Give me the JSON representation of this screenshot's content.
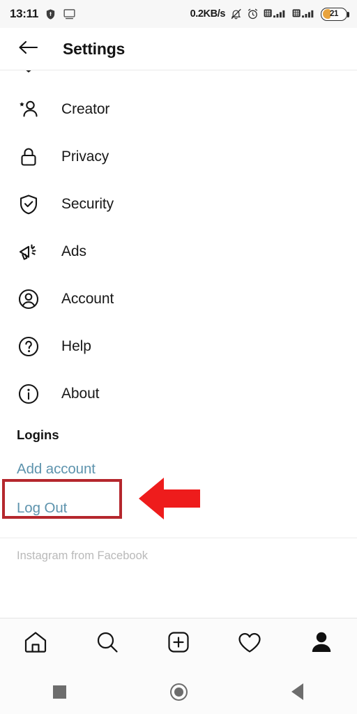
{
  "status_bar": {
    "time": "13:11",
    "network_speed": "0.2KB/s",
    "battery_percent": "21",
    "icons": [
      "shield-icon",
      "cast-screen-icon",
      "bell-muted-icon",
      "alarm-clock-icon",
      "sim1-signal-icon",
      "sim2-signal-icon",
      "battery-icon"
    ]
  },
  "header": {
    "title": "Settings",
    "back_icon": "arrow-left-icon"
  },
  "settings": {
    "items": [
      {
        "label": "Creator",
        "icon": "creator-star-person-icon"
      },
      {
        "label": "Privacy",
        "icon": "lock-icon"
      },
      {
        "label": "Security",
        "icon": "shield-check-icon"
      },
      {
        "label": "Ads",
        "icon": "megaphone-icon"
      },
      {
        "label": "Account",
        "icon": "account-circle-icon"
      },
      {
        "label": "Help",
        "icon": "question-circle-icon"
      },
      {
        "label": "About",
        "icon": "info-circle-icon"
      }
    ]
  },
  "logins": {
    "section_title": "Logins",
    "add_account_label": "Add account",
    "log_out_label": "Log Out",
    "link_color": "#5d93ad",
    "highlight_color": "#b5272d",
    "arrow_color": "#ee1c1c"
  },
  "footer": {
    "note": "Instagram from Facebook"
  },
  "tabbar": {
    "tabs": [
      {
        "name": "home",
        "icon": "home-icon",
        "active": false
      },
      {
        "name": "search",
        "icon": "search-icon",
        "active": false
      },
      {
        "name": "create",
        "icon": "plus-square-icon",
        "active": false
      },
      {
        "name": "activity",
        "icon": "heart-icon",
        "active": false
      },
      {
        "name": "profile",
        "icon": "person-filled-icon",
        "active": true
      }
    ]
  },
  "android_nav": {
    "buttons": [
      {
        "name": "recents",
        "icon": "square-icon"
      },
      {
        "name": "home",
        "icon": "circle-icon"
      },
      {
        "name": "back",
        "icon": "triangle-left-icon"
      }
    ]
  }
}
